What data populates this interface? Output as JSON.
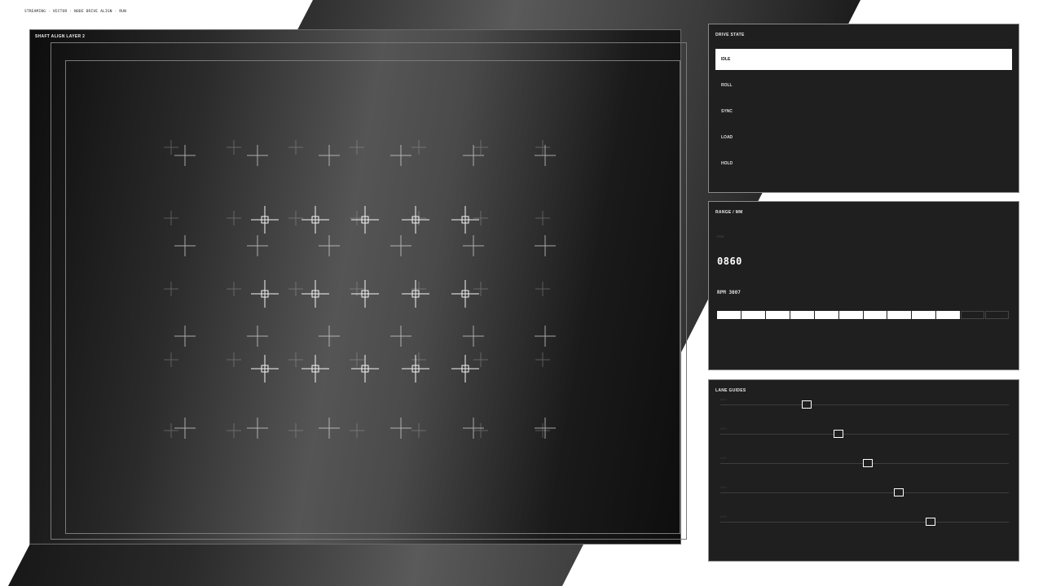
{
  "header": {
    "status_line": "STREAMING · VECTOR · NODE DRIVE ALIGN · RUN"
  },
  "viewport": {
    "title": "SHAFT ALIGN LAYER 2",
    "marker_icon": "crosshair-icon",
    "target_icon": "boxed-crosshair-icon"
  },
  "drive_state": {
    "title": "DRIVE STATE",
    "options": [
      "IDLE",
      "ROLL",
      "SYNC",
      "LOAD",
      "HOLD"
    ],
    "selected": "IDLE"
  },
  "range": {
    "title": "RANGE / MM",
    "small_label": "POS",
    "value": "0860",
    "rpm": "RPM 3007",
    "segments_total": 12,
    "segments_filled": 10
  },
  "lane_guides": {
    "title": "LANE GUIDES",
    "lanes": [
      {
        "label": "LN 1",
        "value": 0.3
      },
      {
        "label": "LN 2",
        "value": 0.41
      },
      {
        "label": "LN 3",
        "value": 0.51
      },
      {
        "label": "LN 4",
        "value": 0.62
      },
      {
        "label": "LN 5",
        "value": 0.73
      }
    ]
  },
  "colors": {
    "accent": "#ffffff",
    "panel_bg": "#1f1f1f",
    "page_bg": "#ffffff"
  }
}
